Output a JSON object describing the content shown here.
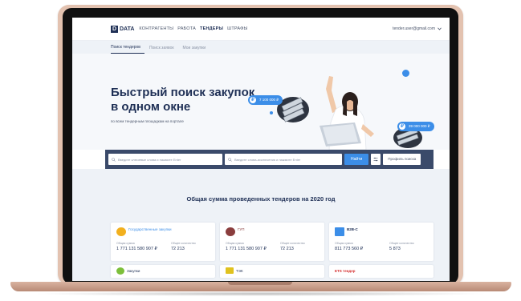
{
  "nav": {
    "logo_mark": "D",
    "logo_text": "DATA",
    "items": [
      "КОНТРАГЕНТЫ",
      "РАБОТА",
      "ТЕНДЕРЫ",
      "ШТРАФЫ"
    ],
    "user_email": "tender.user@gmail.com"
  },
  "subtabs": [
    "Поиск тендеров",
    "Поиск заявок",
    "Мои закупки"
  ],
  "hero": {
    "title": "Быстрый поиск закупок в одном окне",
    "subtitle": "по всем тендерным площадкам на портале",
    "badge1": "7 100 000 ₽",
    "badge2": "39 000 000 ₽",
    "coin_symbol": "₽"
  },
  "search": {
    "field1_placeholder": "Введите ключевые слова и нажмите Enter",
    "field2_placeholder": "Введите слова-исключения и нажмите Enter",
    "find_label": "Найти",
    "reset_label": "Профиль поиска"
  },
  "stats": {
    "title": "Общая сумма проведенных тендеров на 2020 год",
    "cards": [
      {
        "name": "Государственные закупки",
        "label_sum": "Общая сумма",
        "label_count": "Общее количество",
        "sum": "1 771 131 580 907 ₽",
        "count": "72 213",
        "logo_color": "#f2b01e"
      },
      {
        "name": "ГУП",
        "label_sum": "Общая сумма",
        "label_count": "Общее количество",
        "sum": "1 771 131 580 907 ₽",
        "count": "72 213",
        "logo_color": "#8a3d3d"
      },
      {
        "name": "B2B-C",
        "label_sum": "Общая сумма",
        "label_count": "Общее количество",
        "sum": "811 773 560 ₽",
        "count": "5 873",
        "logo_color": "#3c8ee8"
      }
    ],
    "cards_bottom": [
      "Закупки",
      "ТЭК",
      "ETS тендер"
    ]
  },
  "colors": {
    "accent": "#3c8ee8",
    "navy": "#1e2f55",
    "laptop": "#e3c2b0"
  }
}
